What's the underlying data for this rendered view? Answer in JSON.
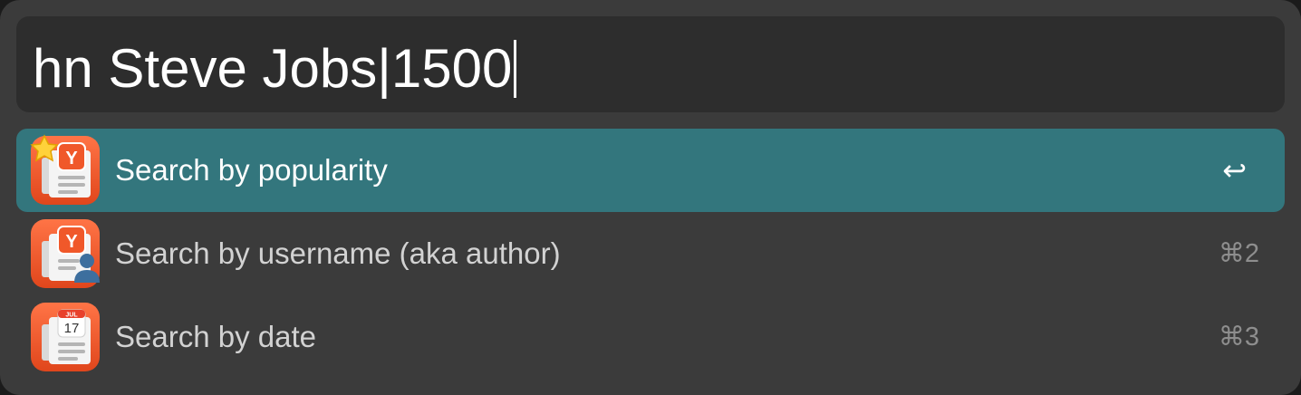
{
  "search": {
    "query": "hn Steve Jobs|1500"
  },
  "results": [
    {
      "title": "Search by popularity",
      "shortcut": "↩",
      "icon": "hackernews-popularity-icon",
      "selected": true
    },
    {
      "title": "Search by username (aka author)",
      "shortcut": "⌘2",
      "icon": "hackernews-author-icon",
      "selected": false
    },
    {
      "title": "Search by date",
      "shortcut": "⌘3",
      "icon": "hackernews-date-icon",
      "selected": false
    }
  ],
  "icons": {
    "calendar_month": "JUL",
    "calendar_day": "17",
    "badge_letter": "Y"
  },
  "colors": {
    "window_bg": "#3b3b3b",
    "query_bg": "#2d2d2d",
    "selection": "#33767d",
    "icon_orange": "#f0582a"
  }
}
